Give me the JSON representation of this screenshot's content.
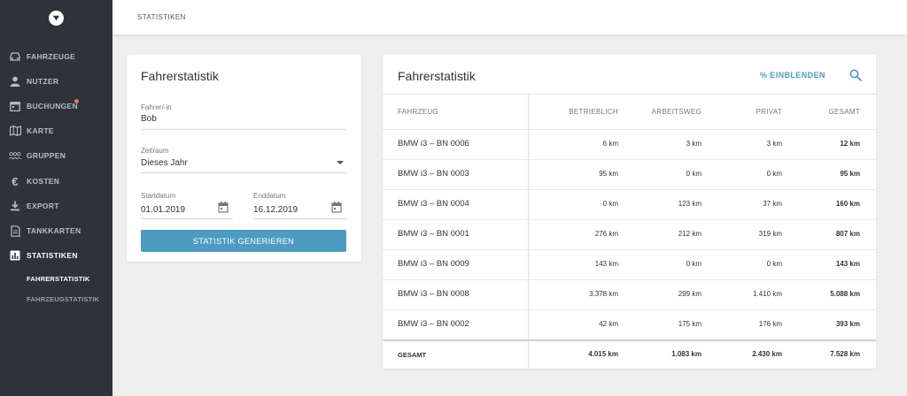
{
  "nav": [
    {
      "label": "Fahrzeuge",
      "icon": "car-icon",
      "active": false
    },
    {
      "label": "Nutzer",
      "icon": "user-icon",
      "active": false
    },
    {
      "label": "Buchungen",
      "icon": "calendar-icon",
      "active": false,
      "badge": true
    },
    {
      "label": "Karte",
      "icon": "map-icon",
      "active": false
    },
    {
      "label": "Gruppen",
      "icon": "group-icon",
      "active": false
    },
    {
      "label": "Kosten",
      "icon": "euro-icon",
      "active": false
    },
    {
      "label": "Export",
      "icon": "download-icon",
      "active": false
    },
    {
      "label": "Tankkarten",
      "icon": "document-icon",
      "active": false
    },
    {
      "label": "Statistiken",
      "icon": "bar-chart-icon",
      "active": true
    }
  ],
  "subnav": [
    {
      "label": "FAHRERSTATISTIK",
      "active": true
    },
    {
      "label": "FAHRZEUGSTATISTIK",
      "active": false
    }
  ],
  "header": {
    "breadcrumb": "STATISTIKEN"
  },
  "form": {
    "title": "Fahrerstatistik",
    "driver_label": "Fahrer/-in",
    "driver_value": "Bob",
    "period_label": "Zeitraum",
    "period_value": "Dieses Jahr",
    "start_label": "Startdatum",
    "start_value": "01.01.2019",
    "end_label": "Enddatum",
    "end_value": "16.12.2019",
    "button_label": "STATISTIK GENERIEREN"
  },
  "table": {
    "title": "Fahrerstatistik",
    "toggle_label": "% EINBLENDEN",
    "columns": [
      "FAHRZEUG",
      "BETRIEBLICH",
      "ARBEITSWEG",
      "PRIVAT",
      "GESAMT"
    ],
    "rows": [
      [
        "BMW i3 – BN 0006",
        "6 km",
        "3 km",
        "3 km",
        "12 km"
      ],
      [
        "BMW i3 – BN 0003",
        "95 km",
        "0 km",
        "0 km",
        "95 km"
      ],
      [
        "BMW i3 – BN 0004",
        "0 km",
        "123 km",
        "37 km",
        "160 km"
      ],
      [
        "BMW i3 – BN 0001",
        "276 km",
        "212 km",
        "319 km",
        "807 km"
      ],
      [
        "BMW i3 – BN 0009",
        "143 km",
        "0 km",
        "0 km",
        "143 km"
      ],
      [
        "BMW i3 – BN 0008",
        "3.378 km",
        "299 km",
        "1.410 km",
        "5.088 km"
      ],
      [
        "BMW i3 – BN 0002",
        "42 km",
        "175 km",
        "176 km",
        "393 km"
      ]
    ],
    "total": [
      "GESAMT",
      "4.015 km",
      "1.083 km",
      "2.430 km",
      "7.528 km"
    ]
  },
  "colors": {
    "accent": "#4d9bc0",
    "sidebar": "#2d3339",
    "badge": "#e8736e"
  }
}
